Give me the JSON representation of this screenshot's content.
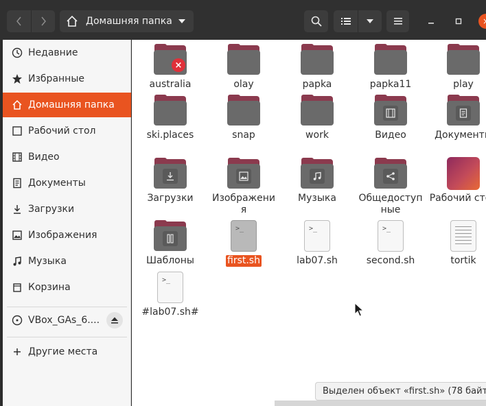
{
  "header": {
    "path_label": "Домашняя папка"
  },
  "sidebar": {
    "items": [
      {
        "label": "Недавние",
        "icon": "clock-icon"
      },
      {
        "label": "Избранные",
        "icon": "star-icon"
      },
      {
        "label": "Домашняя папка",
        "icon": "home-icon",
        "active": true
      },
      {
        "label": "Рабочий стол",
        "icon": "desktop-icon"
      },
      {
        "label": "Видео",
        "icon": "video-icon"
      },
      {
        "label": "Документы",
        "icon": "document-icon"
      },
      {
        "label": "Загрузки",
        "icon": "download-icon"
      },
      {
        "label": "Изображения",
        "icon": "image-icon"
      },
      {
        "label": "Музыка",
        "icon": "music-icon"
      },
      {
        "label": "Корзина",
        "icon": "trash-icon"
      }
    ],
    "device": {
      "label": "VBox_GAs_6....",
      "icon": "disc-icon"
    },
    "other": {
      "label": "Другие места",
      "icon": "plus-icon"
    }
  },
  "files": [
    {
      "name": "australia",
      "type": "folder",
      "badge": "error"
    },
    {
      "name": "olay",
      "type": "folder"
    },
    {
      "name": "papka",
      "type": "folder"
    },
    {
      "name": "papka11",
      "type": "folder"
    },
    {
      "name": "play",
      "type": "folder"
    },
    {
      "name": "ski.places",
      "type": "folder"
    },
    {
      "name": "snap",
      "type": "folder"
    },
    {
      "name": "work",
      "type": "folder"
    },
    {
      "name": "Видео",
      "type": "folder",
      "emblem": "film-icon"
    },
    {
      "name": "Документы",
      "type": "folder",
      "emblem": "document-icon"
    },
    {
      "name": "Загрузки",
      "type": "folder",
      "emblem": "download-icon"
    },
    {
      "name": "Изображения",
      "type": "folder",
      "emblem": "image-icon"
    },
    {
      "name": "Музыка",
      "type": "folder",
      "emblem": "music-icon"
    },
    {
      "name": "Общедоступные",
      "type": "folder",
      "emblem": "share-icon"
    },
    {
      "name": "Рабочий стол",
      "type": "desktop"
    },
    {
      "name": "Шаблоны",
      "type": "folder",
      "emblem": "template-icon"
    },
    {
      "name": "first.sh",
      "type": "script",
      "selected": true
    },
    {
      "name": "lab07.sh",
      "type": "script"
    },
    {
      "name": "second.sh",
      "type": "script"
    },
    {
      "name": "tortik",
      "type": "text"
    },
    {
      "name": "#lab07.sh#",
      "type": "script"
    }
  ],
  "status": {
    "text": "Выделен объект «first.sh» (78 байт"
  },
  "colors": {
    "accent": "#e95420",
    "folder_tab": "#8b3a4e",
    "folder_body": "#6a6a6a"
  }
}
